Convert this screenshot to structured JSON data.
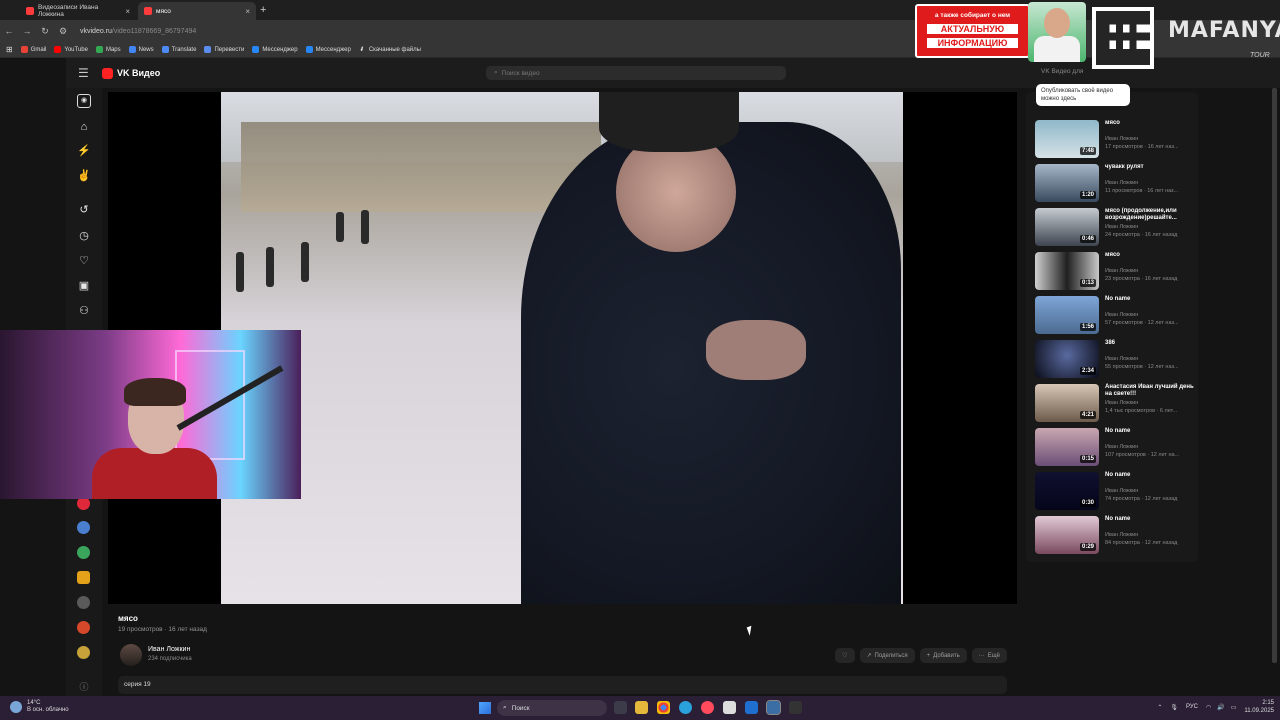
{
  "browser": {
    "tabs": [
      {
        "title": "Видеозаписи Ивана Ложкина",
        "active": false
      },
      {
        "title": "мясо",
        "active": true
      }
    ],
    "url_host": "vkvideo.ru",
    "url_path": "/video11878669_86797494",
    "bookmarks": [
      "Gmail",
      "YouTube",
      "Maps",
      "News",
      "Translate",
      "Перевести",
      "Мессенджер",
      "Мессенджер",
      "Скачанные файлы"
    ]
  },
  "overlay_ad": {
    "line1": "а также собирает о нем",
    "line2": "АКТУАЛЬНУЮ",
    "line3": "ИНФОРМАЦИЮ",
    "brand": "MAFANYA",
    "brand_sub": "TOUR"
  },
  "vk": {
    "logo": "VK Видео",
    "search_placeholder": "Поиск видео",
    "for_label": "VK Видео для",
    "tooltip": "Опубликовать своё видео можно здесь"
  },
  "video": {
    "title": "мясо",
    "views": "19 просмотров",
    "age": "16 лет назад",
    "channel": "Иван Ложкин",
    "subscribers": "234 подписчика",
    "description": "серия 19",
    "actions": {
      "share": "Поделиться",
      "add": "Добавить",
      "more": "Ещё"
    }
  },
  "recommendations": [
    {
      "title": "мясо",
      "channel": "Иван Ложкин",
      "meta": "17 просмотров · 16 лет наз...",
      "duration": "7:48"
    },
    {
      "title": "чувакк рулят",
      "channel": "Иван Ложкин",
      "meta": "11 просмотров · 16 лет наз...",
      "duration": "1:20"
    },
    {
      "title": "мясо (продолжение,или возрождение)решайте...",
      "channel": "Иван Ложкин",
      "meta": "24 просмотра · 16 лет назад",
      "duration": "0:46"
    },
    {
      "title": "мясо",
      "channel": "Иван Ложкин",
      "meta": "23 просмотра · 16 лет назад",
      "duration": "0:13"
    },
    {
      "title": "No name",
      "channel": "Иван Ложкин",
      "meta": "57 просмотров · 12 лет наз...",
      "duration": "1:56"
    },
    {
      "title": "386",
      "channel": "Иван Ложкин",
      "meta": "55 просмотров · 12 лет наз...",
      "duration": "2:34"
    },
    {
      "title": "Анастасия Иван лучший день на свете!!!",
      "channel": "Иван Ложкин",
      "meta": "1,4 тыс просмотров · 6 лет...",
      "duration": "4:21"
    },
    {
      "title": "No name",
      "channel": "Иван Ложкин",
      "meta": "107 просмотров · 12 лет на...",
      "duration": "0:15"
    },
    {
      "title": "No name",
      "channel": "Иван Ложкин",
      "meta": "74 просмотра · 12 лет назад",
      "duration": "0:30"
    },
    {
      "title": "No name",
      "channel": "Иван Ложкин",
      "meta": "84 просмотра · 12 лет назад",
      "duration": "0:29"
    }
  ],
  "taskbar": {
    "temperature": "14°C",
    "weather": "В осн. облачно",
    "search_label": "Поиск",
    "lang": "РУС",
    "time": "2:15",
    "date": "11.09.2025"
  },
  "colors": {
    "accent": "#ff3b3b",
    "vk_red": "#f22",
    "bg": "#141414"
  }
}
